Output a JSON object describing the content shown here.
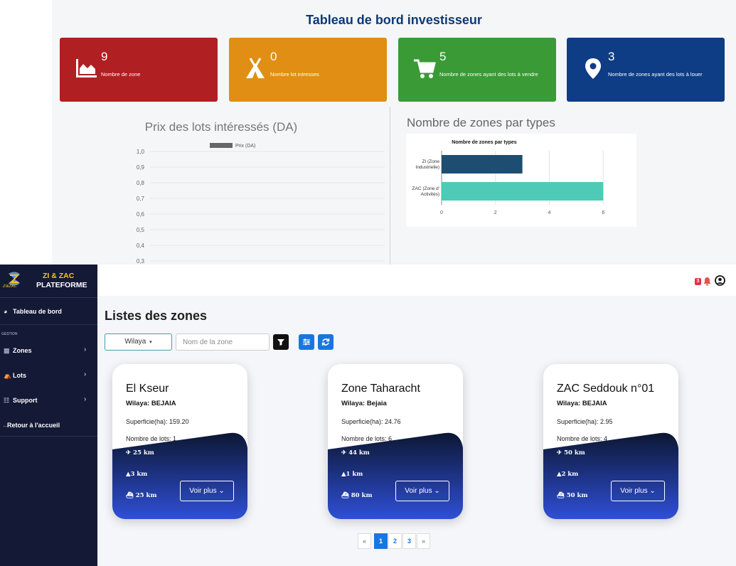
{
  "dashboard": {
    "title": "Tableau de bord investisseur",
    "cards": [
      {
        "value": "9",
        "label": "Nombre de zone",
        "icon": "area-chart-icon",
        "color": "#b01f22"
      },
      {
        "value": "0",
        "label": "Nombre lot intresses",
        "icon": "tent-icon",
        "color": "#e08f14"
      },
      {
        "value": "5",
        "label": "Nombre de zones ayant des lots à vendre",
        "icon": "cart-icon",
        "color": "#3a9a35"
      },
      {
        "value": "3",
        "label": "Nombre de zones ayant des lots à louer",
        "icon": "map-pin-icon",
        "color": "#0e3d86"
      }
    ]
  },
  "chart_data": [
    {
      "type": "bar",
      "title": "Prix des lots intéressés (DA)",
      "series": [
        {
          "name": "Prix (DA)",
          "values": []
        }
      ],
      "y_ticks": [
        "1,0",
        "0,9",
        "0,8",
        "0,7",
        "0,6",
        "0,5",
        "0,4",
        "0,3"
      ],
      "ylim": [
        0,
        1
      ],
      "grid": true,
      "legend": "top"
    },
    {
      "type": "bar",
      "orientation": "horizontal",
      "title": "Nombre de zones par types",
      "inner_title": "Nombre de zones par types",
      "categories": [
        [
          "ZI (Zone",
          "Industrielle)"
        ],
        [
          "ZAC (Zone d'",
          "Activités)"
        ]
      ],
      "values": [
        3,
        6
      ],
      "colors": [
        "#1d4e72",
        "#4ecbb6"
      ],
      "x_ticks": [
        "0",
        "2",
        "4",
        "6"
      ],
      "xlim": [
        0,
        6.6
      ],
      "grid": true
    }
  ],
  "brand": {
    "line1": "ZI & ZAC",
    "line2": "PLATEFORME",
    "sub": "ZI&ZAC"
  },
  "sidebar": {
    "dashboard": "Tableau de bord",
    "section": "GESTION",
    "items": [
      {
        "label": "Zones",
        "icon": "map-icon"
      },
      {
        "label": "Lots",
        "icon": "building-icon"
      },
      {
        "label": "Support",
        "icon": "users-icon"
      }
    ],
    "back": "Retour à l'accueil"
  },
  "topbar": {
    "notification_count": "3"
  },
  "main": {
    "title": "Listes des zones",
    "wilaya_label": "Wilaya",
    "search_placeholder": "Nom de la zone",
    "zones": [
      {
        "name": "El Kseur",
        "wilaya": "Wilaya: BEJAIA",
        "superficie": "Superficie(ha): 159.20",
        "lots": "Nombre de lots: 1",
        "airport": "25 km",
        "road": "3 km",
        "port": "25 km",
        "button": "Voir plus"
      },
      {
        "name": "Zone Taharacht",
        "wilaya": "Wilaya: Bejaia",
        "superficie": "Superficie(ha): 24.76",
        "lots": "Nombre de lots: 6",
        "airport": "44 km",
        "road": "1 km",
        "port": "80 km",
        "button": "Voir plus"
      },
      {
        "name": "ZAC Seddouk n°01",
        "wilaya": "Wilaya: BEJAIA",
        "superficie": "Superficie(ha): 2.95",
        "lots": "Nombre de lots: 4",
        "airport": "50 km",
        "road": "2 km",
        "port": "50 km",
        "button": "Voir plus"
      }
    ],
    "pagination": {
      "prev": "«",
      "pages": [
        "1",
        "2",
        "3"
      ],
      "next": "»",
      "current": "1"
    }
  }
}
